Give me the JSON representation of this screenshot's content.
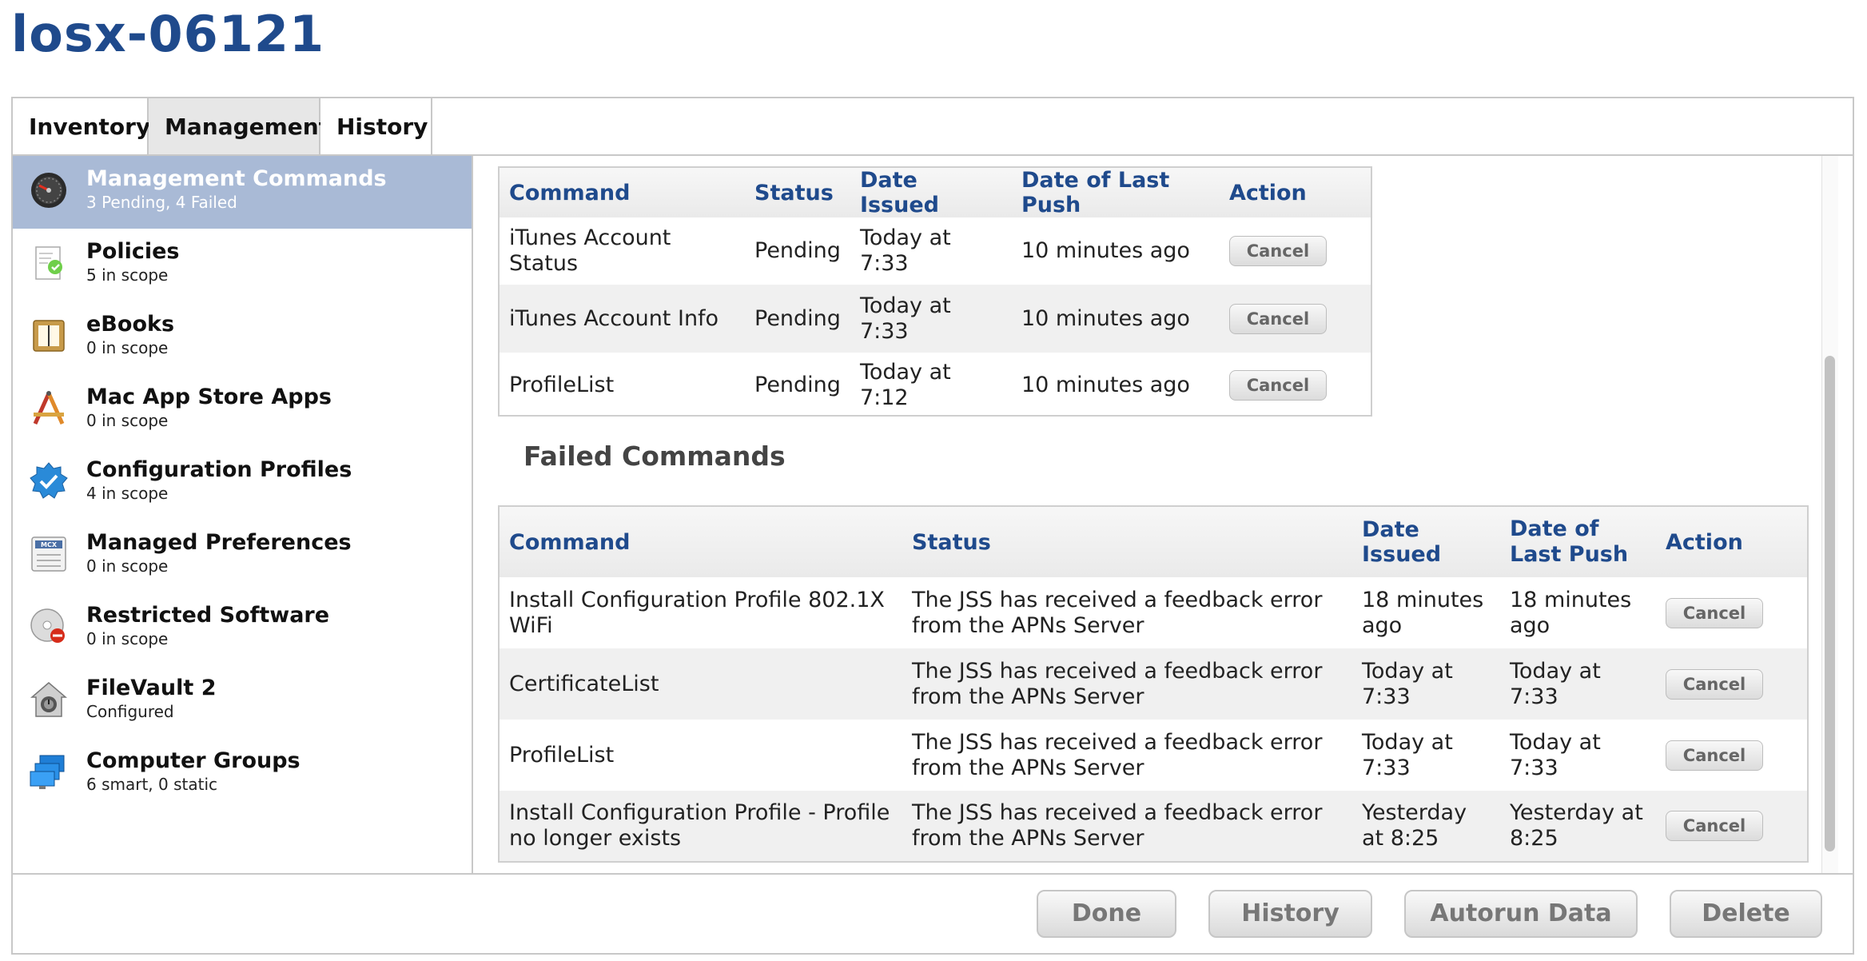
{
  "page": {
    "title": "losx-06121"
  },
  "tabs": [
    {
      "label": "Inventory",
      "active": false
    },
    {
      "label": "Management",
      "active": true
    },
    {
      "label": "History",
      "active": false
    }
  ],
  "sidebar": {
    "items": [
      {
        "title": "Management Commands",
        "subtitle": "3 Pending, 4 Failed",
        "icon": "gauge-icon",
        "selected": true
      },
      {
        "title": "Policies",
        "subtitle": "5 in scope",
        "icon": "policy-document-icon"
      },
      {
        "title": "eBooks",
        "subtitle": "0 in scope",
        "icon": "book-icon"
      },
      {
        "title": "Mac App Store Apps",
        "subtitle": "0 in scope",
        "icon": "app-store-icon"
      },
      {
        "title": "Configuration Profiles",
        "subtitle": "4 in scope",
        "icon": "badge-check-icon"
      },
      {
        "title": "Managed Preferences",
        "subtitle": "0 in scope",
        "icon": "mcx-preferences-icon"
      },
      {
        "title": "Restricted Software",
        "subtitle": "0 in scope",
        "icon": "restricted-disc-icon"
      },
      {
        "title": "FileVault 2",
        "subtitle": "Configured",
        "icon": "filevault-house-icon"
      },
      {
        "title": "Computer Groups",
        "subtitle": "6 smart, 0 static",
        "icon": "computer-group-icon"
      }
    ]
  },
  "pending": {
    "headers": {
      "command": "Command",
      "status": "Status",
      "date_issued": "Date Issued",
      "last_push": "Date of Last Push",
      "action": "Action"
    },
    "rows": [
      {
        "command": "iTunes Account Status",
        "status": "Pending",
        "date_issued": "Today at 7:33",
        "last_push": "10 minutes ago",
        "action": "Cancel"
      },
      {
        "command": "iTunes Account Info",
        "status": "Pending",
        "date_issued": "Today at 7:33",
        "last_push": "10 minutes ago",
        "action": "Cancel"
      },
      {
        "command": "ProfileList",
        "status": "Pending",
        "date_issued": "Today at 7:12",
        "last_push": "10 minutes ago",
        "action": "Cancel"
      }
    ]
  },
  "failed": {
    "title": "Failed Commands",
    "headers": {
      "command": "Command",
      "status": "Status",
      "date_issued": "Date Issued",
      "last_push": "Date of Last Push",
      "action": "Action"
    },
    "rows": [
      {
        "command": "Install Configuration Profile 802.1X WiFi",
        "status": "The JSS has received a feedback error from the APNs Server",
        "date_issued": "18 minutes ago",
        "last_push": "18 minutes ago",
        "action": "Cancel"
      },
      {
        "command": "CertificateList",
        "status": "The JSS has received a feedback error from the APNs Server",
        "date_issued": "Today at 7:33",
        "last_push": "Today at 7:33",
        "action": "Cancel"
      },
      {
        "command": "ProfileList",
        "status": "The JSS has received a feedback error from the APNs Server",
        "date_issued": "Today at 7:33",
        "last_push": "Today at 7:33",
        "action": "Cancel"
      },
      {
        "command": "Install Configuration Profile - Profile no longer exists",
        "status": "The JSS has received a feedback error from the APNs Server",
        "date_issued": "Yesterday at 8:25",
        "last_push": "Yesterday at 8:25",
        "action": "Cancel"
      }
    ]
  },
  "footer": {
    "done": "Done",
    "history": "History",
    "autorun": "Autorun Data",
    "delete": "Delete"
  },
  "colors": {
    "accent": "#1f4a8c",
    "selected_bg": "#a9bad6"
  }
}
